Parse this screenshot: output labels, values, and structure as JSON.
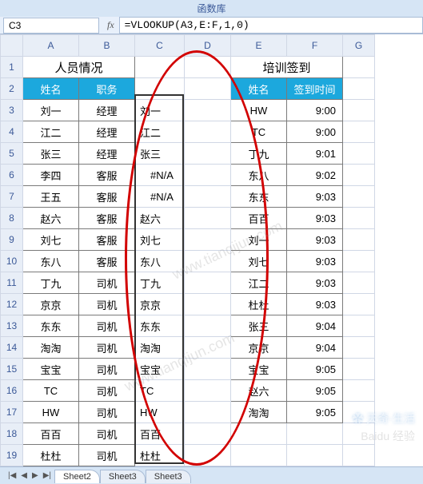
{
  "ribbon_group": "函数库",
  "namebox": "C3",
  "formula": "=VLOOKUP(A3,E:F,1,0)",
  "columns": [
    "A",
    "B",
    "C",
    "D",
    "E",
    "F",
    "G"
  ],
  "title_left": "人员情况",
  "title_right": "培训签到",
  "hdr": {
    "name": "姓名",
    "role": "职务",
    "name2": "姓名",
    "time": "签到时间"
  },
  "chart_data": {
    "type": "table",
    "left": [
      {
        "name": "刘一",
        "role": "经理",
        "c": "刘一"
      },
      {
        "name": "江二",
        "role": "经理",
        "c": "江二"
      },
      {
        "name": "张三",
        "role": "经理",
        "c": "张三"
      },
      {
        "name": "李四",
        "role": "客服",
        "c": "#N/A"
      },
      {
        "name": "王五",
        "role": "客服",
        "c": "#N/A"
      },
      {
        "name": "赵六",
        "role": "客服",
        "c": "赵六"
      },
      {
        "name": "刘七",
        "role": "客服",
        "c": "刘七"
      },
      {
        "name": "东八",
        "role": "客服",
        "c": "东八"
      },
      {
        "name": "丁九",
        "role": "司机",
        "c": "丁九"
      },
      {
        "name": "京京",
        "role": "司机",
        "c": "京京"
      },
      {
        "name": "东东",
        "role": "司机",
        "c": "东东"
      },
      {
        "name": "淘淘",
        "role": "司机",
        "c": "淘淘"
      },
      {
        "name": "宝宝",
        "role": "司机",
        "c": "宝宝"
      },
      {
        "name": "TC",
        "role": "司机",
        "c": "TC"
      },
      {
        "name": "HW",
        "role": "司机",
        "c": "HW"
      },
      {
        "name": "百百",
        "role": "司机",
        "c": "百百"
      },
      {
        "name": "杜杜",
        "role": "司机",
        "c": "杜杜"
      }
    ],
    "right": [
      {
        "name": "HW",
        "time": "9:00"
      },
      {
        "name": "TC",
        "time": "9:00"
      },
      {
        "name": "丁九",
        "time": "9:01"
      },
      {
        "name": "东八",
        "time": "9:02"
      },
      {
        "name": "东东",
        "time": "9:03"
      },
      {
        "name": "百百",
        "time": "9:03"
      },
      {
        "name": "刘一",
        "time": "9:03"
      },
      {
        "name": "刘七",
        "time": "9:03"
      },
      {
        "name": "江二",
        "time": "9:03"
      },
      {
        "name": "杜杜",
        "time": "9:03"
      },
      {
        "name": "张三",
        "time": "9:04"
      },
      {
        "name": "京京",
        "time": "9:04"
      },
      {
        "name": "宝宝",
        "time": "9:05"
      },
      {
        "name": "赵六",
        "time": "9:05"
      },
      {
        "name": "淘淘",
        "time": "9:05"
      }
    ]
  },
  "tabs": [
    "Sheet2",
    "Sheet3",
    "Sheet3"
  ],
  "watermark": "www.tianqijun.com",
  "brand1": "✿ 天奇·生活",
  "brand2": "Baidu 经验"
}
